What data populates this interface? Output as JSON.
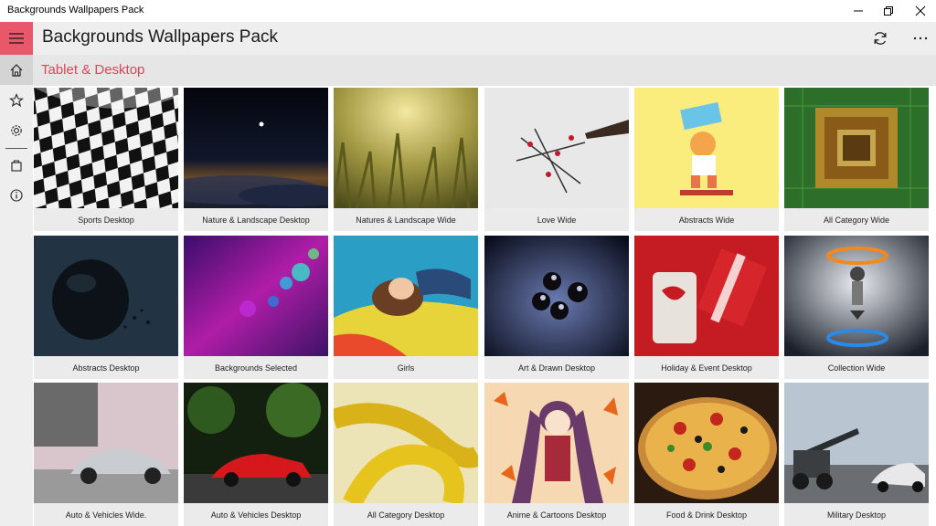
{
  "window": {
    "title": "Backgrounds Wallpapers Pack",
    "controls": [
      "minimize",
      "maximize",
      "close"
    ]
  },
  "header": {
    "app_title": "Backgrounds Wallpapers Pack",
    "refresh_icon": "refresh-icon",
    "more_icon": "more-icon"
  },
  "rail": {
    "items": [
      {
        "icon": "home-icon",
        "active": true
      },
      {
        "icon": "star-icon",
        "active": false
      },
      {
        "icon": "gear-icon",
        "active": false
      },
      {
        "icon": "store-icon",
        "active": false
      },
      {
        "icon": "info-icon",
        "active": false
      }
    ]
  },
  "section": {
    "title": "Tablet & Desktop"
  },
  "tiles": [
    {
      "label": "Sports Desktop"
    },
    {
      "label": "Nature & Landscape Desktop"
    },
    {
      "label": "Natures & Landscape Wide"
    },
    {
      "label": "Love Wide"
    },
    {
      "label": "Abstracts Wide"
    },
    {
      "label": "All Category Wide"
    },
    {
      "label": "Abstracts Desktop"
    },
    {
      "label": "Backgrounds Selected"
    },
    {
      "label": "Girls"
    },
    {
      "label": "Art & Drawn Desktop"
    },
    {
      "label": "Holiday & Event Desktop"
    },
    {
      "label": "Collection Wide"
    },
    {
      "label": "Auto & Vehicles Wide."
    },
    {
      "label": "Auto & Vehicles Desktop"
    },
    {
      "label": "All Category Desktop"
    },
    {
      "label": "Anime & Cartoons Desktop"
    },
    {
      "label": "Food & Drink Desktop"
    },
    {
      "label": "Military Desktop"
    }
  ],
  "colors": {
    "accent": "#e8586a",
    "section_title": "#e0445b",
    "chrome": "#eeeeee"
  }
}
